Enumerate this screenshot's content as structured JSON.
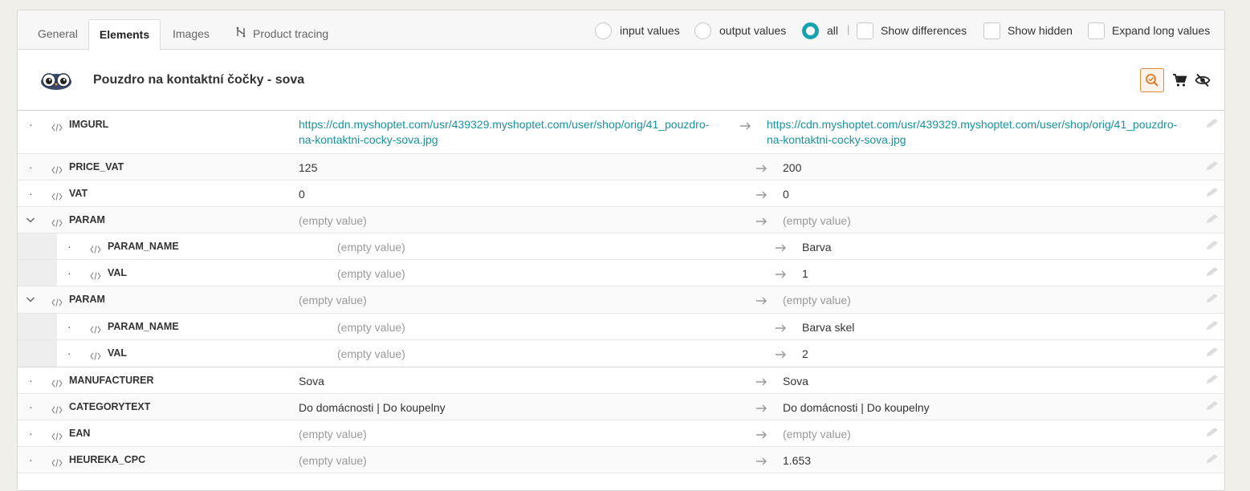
{
  "tabs": [
    {
      "label": "General",
      "active": false
    },
    {
      "label": "Elements",
      "active": true
    },
    {
      "label": "Images",
      "active": false
    },
    {
      "label": "Product tracing",
      "active": false,
      "icon": "flow-icon"
    }
  ],
  "view_options": {
    "radios": [
      {
        "label": "input values",
        "checked": false
      },
      {
        "label": "output values",
        "checked": false
      },
      {
        "label": "all",
        "checked": true
      }
    ],
    "separator": "|",
    "checkboxes": [
      {
        "label": "Show differences",
        "checked": false
      },
      {
        "label": "Show hidden",
        "checked": false
      },
      {
        "label": "Expand long values",
        "checked": false
      }
    ]
  },
  "product": {
    "title": "Pouzdro na kontaktní čočky - sova",
    "thumbnail": "owl-image",
    "actions": [
      "search-check-icon",
      "cart-icon",
      "eye-slash-icon"
    ]
  },
  "rows": [
    {
      "name": "IMGURL",
      "input": "https://cdn.myshoptet.com/usr/439329.myshoptet.com/user/shop/orig/41_pouzdro-na-kontaktni-cocky-sova.jpg",
      "output": "https://cdn.myshoptet.com/usr/439329.myshoptet.com/user/shop/orig/41_pouzdro-na-kontaktni-cocky-sova.jpg",
      "input_l1": "https://cdn.myshoptet.com/usr/439329.myshoptet.com/user/shop/orig/41_pouzdro-",
      "input_l2": "na-kontaktni-cocky-sova.jpg",
      "output_l1": "https://cdn.myshoptet.com/usr/439329.myshoptet.com/user/shop/orig/41_pouzdro-",
      "output_l2": "na-kontaktni-cocky-sova.jpg"
    },
    {
      "name": "PRICE_VAT",
      "input": "125",
      "output": "200"
    },
    {
      "name": "VAT",
      "input": "0",
      "output": "0"
    },
    {
      "name": "PARAM",
      "input": "(empty value)",
      "output": "(empty value)",
      "expanded": true
    },
    {
      "name": "PARAM_NAME",
      "input": "(empty value)",
      "output": "Barva",
      "child": true
    },
    {
      "name": "VAL",
      "input": "(empty value)",
      "output": "1",
      "child": true
    },
    {
      "name": "PARAM",
      "input": "(empty value)",
      "output": "(empty value)",
      "expanded": true
    },
    {
      "name": "PARAM_NAME",
      "input": "(empty value)",
      "output": "Barva skel",
      "child": true
    },
    {
      "name": "VAL",
      "input": "(empty value)",
      "output": "2",
      "child": true
    },
    {
      "name": "MANUFACTURER",
      "input": "Sova",
      "output": "Sova"
    },
    {
      "name": "CATEGORYTEXT",
      "input": "Do domácnosti | Do koupelny",
      "output": "Do domácnosti | Do koupelny"
    },
    {
      "name": "EAN",
      "input": "(empty value)",
      "output": "(empty value)"
    },
    {
      "name": "HEUREKA_CPC",
      "input": "(empty value)",
      "output": "1.653"
    }
  ],
  "bullet": "·"
}
